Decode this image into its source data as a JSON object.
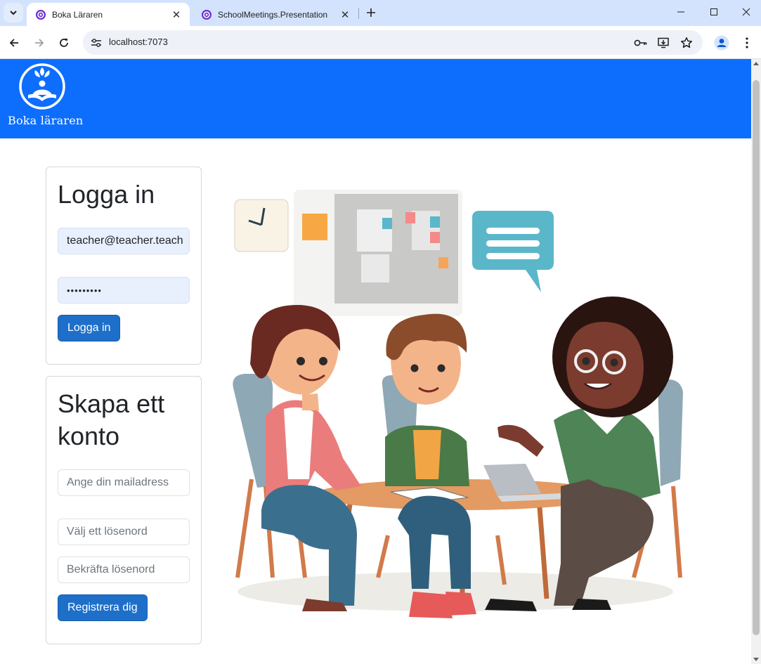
{
  "browser": {
    "tabs": [
      {
        "title": "Boka Läraren",
        "active": true
      },
      {
        "title": "SchoolMeetings.Presentation",
        "active": false
      }
    ],
    "url": "localhost:7073",
    "icons": {
      "tab_search": "chevron-down-icon",
      "new_tab": "plus-icon",
      "back": "arrow-left-icon",
      "forward": "arrow-right-icon",
      "reload": "reload-icon",
      "site_info": "tune-icon",
      "password": "key-icon",
      "install": "install-app-icon",
      "bookmark": "star-icon",
      "profile": "person-icon",
      "menu": "kebab-icon"
    }
  },
  "header": {
    "brand": "Boka läraren",
    "color": "#0d6efd"
  },
  "login": {
    "title": "Logga in",
    "email_value": "teacher@teacher.teach",
    "password_value": "•••••••••",
    "submit_label": "Logga in"
  },
  "register": {
    "title": "Skapa ett konto",
    "email_placeholder": "Ange din mailadress",
    "password_placeholder": "Välj ett lösenord",
    "confirm_placeholder": "Bekräfta lösenord",
    "submit_label": "Registrera dig"
  },
  "colors": {
    "primary_button": "#1e6fc9",
    "autofill": "#e8f0fe"
  }
}
